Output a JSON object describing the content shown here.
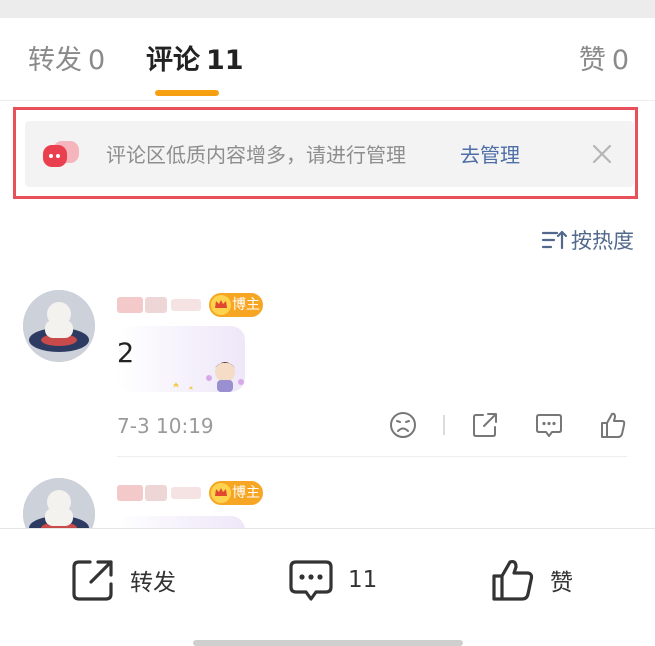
{
  "tabs": {
    "repost": {
      "label": "转发",
      "count": "0"
    },
    "comments": {
      "label": "评论",
      "count": "11"
    },
    "likes": {
      "label": "赞",
      "count": "0"
    }
  },
  "notice": {
    "text": "评论区低质内容增多，请进行管理",
    "link": "去管理",
    "icon": "chat-bubbles-icon",
    "close_icon": "close-icon"
  },
  "sort": {
    "label": "按热度",
    "icon": "sort-icon"
  },
  "comments": [
    {
      "badge": "博主",
      "text": "2",
      "time": "7-3 10:19",
      "actions": [
        "sad-face-icon",
        "share-icon",
        "comment-icon",
        "like-icon"
      ]
    },
    {
      "badge": "博主"
    }
  ],
  "bottom_bar": {
    "repost_label": "转发",
    "comment_count": "11",
    "like_label": "赞"
  },
  "colors": {
    "accent": "#f7a012",
    "link": "#4d6ea8",
    "highlight_border": "#e8505b",
    "badge": "#f6a623"
  }
}
